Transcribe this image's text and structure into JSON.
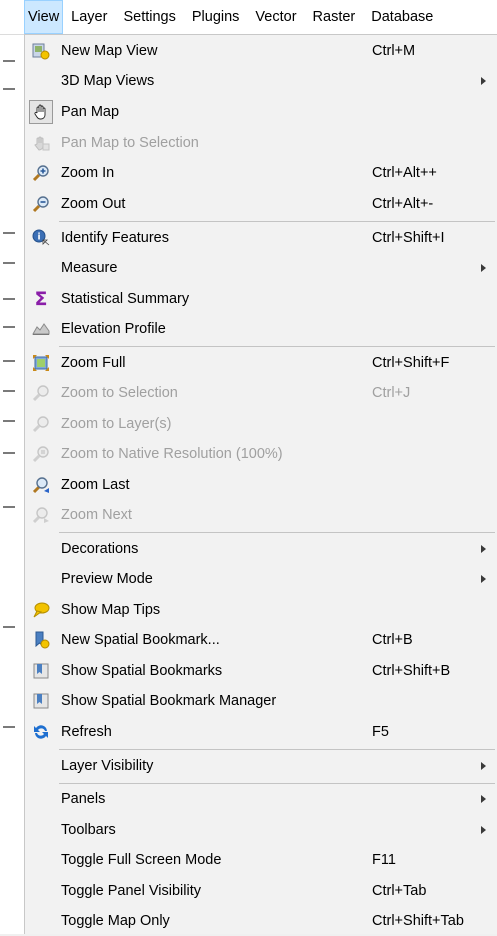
{
  "menubar": {
    "items": [
      "View",
      "Layer",
      "Settings",
      "Plugins",
      "Vector",
      "Raster",
      "Database"
    ]
  },
  "menu": {
    "items": [
      {
        "label": "New Map View",
        "shortcut": "Ctrl+M",
        "icon": "new-map-view-icon",
        "disabled": false
      },
      {
        "label": "3D Map Views",
        "shortcut": "",
        "icon": "",
        "submenu": true,
        "disabled": false
      },
      {
        "label": "Pan Map",
        "shortcut": "",
        "icon": "pan-hand-icon",
        "disabled": false
      },
      {
        "label": "Pan Map to Selection",
        "shortcut": "",
        "icon": "pan-to-selection-icon",
        "disabled": true
      },
      {
        "label": "Zoom In",
        "shortcut": "Ctrl+Alt++",
        "icon": "zoom-in-icon",
        "disabled": false
      },
      {
        "label": "Zoom Out",
        "shortcut": "Ctrl+Alt+-",
        "icon": "zoom-out-icon",
        "disabled": false
      },
      {
        "label": "Identify Features",
        "shortcut": "Ctrl+Shift+I",
        "icon": "identify-icon",
        "disabled": false
      },
      {
        "label": "Measure",
        "shortcut": "",
        "icon": "",
        "submenu": true,
        "disabled": false
      },
      {
        "label": "Statistical Summary",
        "shortcut": "",
        "icon": "sigma-icon",
        "disabled": false
      },
      {
        "label": "Elevation Profile",
        "shortcut": "",
        "icon": "elevation-profile-icon",
        "disabled": false
      },
      {
        "label": "Zoom Full",
        "shortcut": "Ctrl+Shift+F",
        "icon": "zoom-full-icon",
        "disabled": false
      },
      {
        "label": "Zoom to Selection",
        "shortcut": "Ctrl+J",
        "icon": "zoom-to-selection-icon",
        "disabled": true
      },
      {
        "label": "Zoom to Layer(s)",
        "shortcut": "",
        "icon": "zoom-to-layer-icon",
        "disabled": true
      },
      {
        "label": "Zoom to Native Resolution (100%)",
        "shortcut": "",
        "icon": "zoom-native-icon",
        "disabled": true
      },
      {
        "label": "Zoom Last",
        "shortcut": "",
        "icon": "zoom-last-icon",
        "disabled": false
      },
      {
        "label": "Zoom Next",
        "shortcut": "",
        "icon": "zoom-next-icon",
        "disabled": true
      },
      {
        "label": "Decorations",
        "shortcut": "",
        "icon": "",
        "submenu": true,
        "disabled": false
      },
      {
        "label": "Preview Mode",
        "shortcut": "",
        "icon": "",
        "submenu": true,
        "disabled": false
      },
      {
        "label": "Show Map Tips",
        "shortcut": "",
        "icon": "map-tips-icon",
        "disabled": false
      },
      {
        "label": "New Spatial Bookmark...",
        "shortcut": "Ctrl+B",
        "icon": "new-bookmark-icon",
        "disabled": false
      },
      {
        "label": "Show Spatial Bookmarks",
        "shortcut": "Ctrl+Shift+B",
        "icon": "bookmarks-icon",
        "disabled": false
      },
      {
        "label": "Show Spatial Bookmark Manager",
        "shortcut": "",
        "icon": "bookmark-manager-icon",
        "disabled": false
      },
      {
        "label": "Refresh",
        "shortcut": "F5",
        "icon": "refresh-icon",
        "disabled": false
      },
      {
        "label": "Layer Visibility",
        "shortcut": "",
        "icon": "",
        "submenu": true,
        "disabled": false
      },
      {
        "label": "Panels",
        "shortcut": "",
        "icon": "",
        "submenu": true,
        "disabled": false
      },
      {
        "label": "Toolbars",
        "shortcut": "",
        "icon": "",
        "submenu": true,
        "disabled": false
      },
      {
        "label": "Toggle Full Screen Mode",
        "shortcut": "F11",
        "icon": "",
        "disabled": false
      },
      {
        "label": "Toggle Panel Visibility",
        "shortcut": "Ctrl+Tab",
        "icon": "",
        "disabled": false
      },
      {
        "label": "Toggle Map Only",
        "shortcut": "Ctrl+Shift+Tab",
        "icon": "",
        "disabled": false
      }
    ]
  },
  "colors": {
    "highlight": "#cce8ff",
    "disabled_text": "#a0a0a0",
    "sigma": "#8a1ea8",
    "refresh": "#1e6fd0",
    "map_tips": "#f2c200"
  }
}
